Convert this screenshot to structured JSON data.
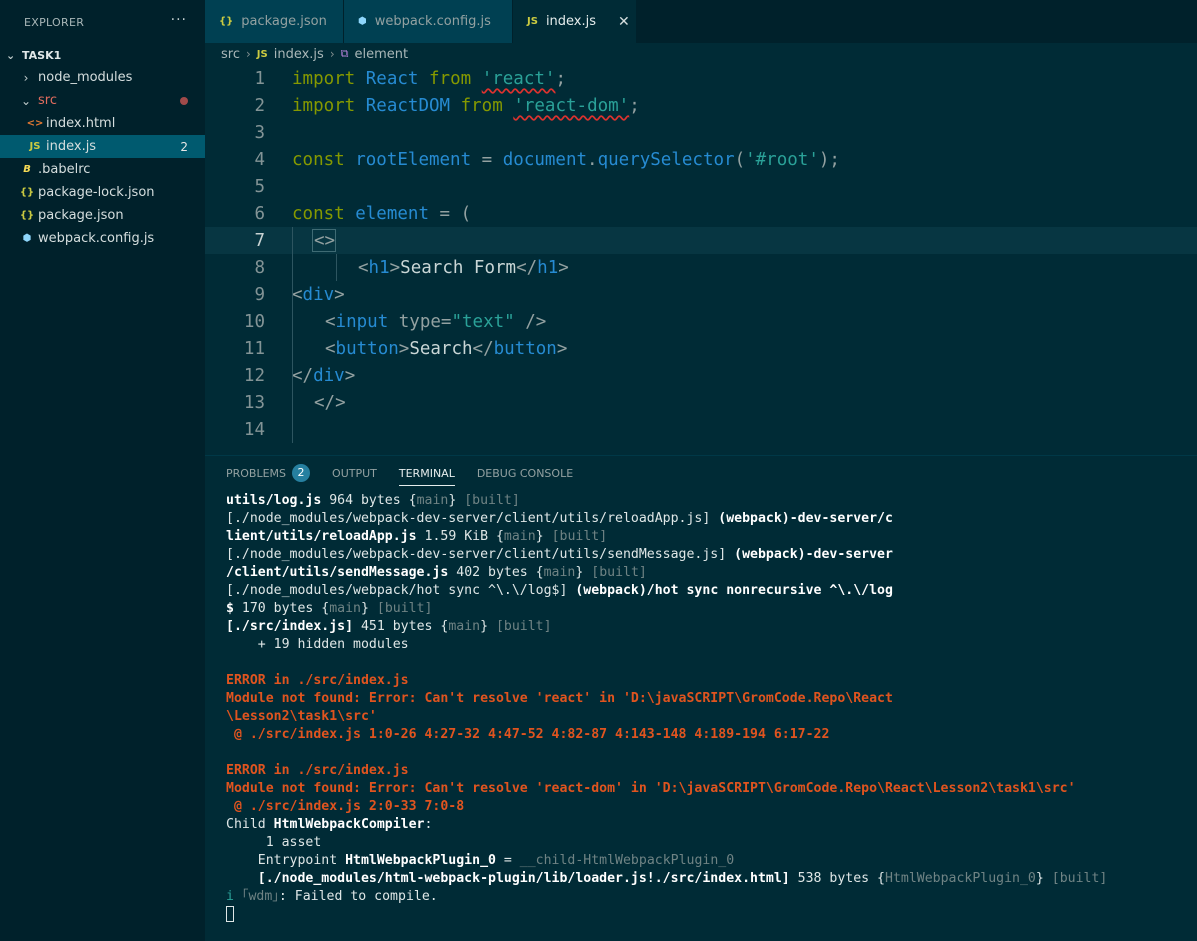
{
  "sidebar": {
    "header": "EXPLORER",
    "more": "···",
    "section": "TASK1",
    "items": [
      {
        "label": "node_modules",
        "icon": "chevron-right-icon",
        "chev": "›"
      },
      {
        "label": "src",
        "icon": "chevron-down-icon",
        "chev": "⌄"
      },
      {
        "label": "index.html",
        "icon_text": "<>"
      },
      {
        "label": "index.js",
        "icon_text": "JS",
        "count": "2"
      },
      {
        "label": ".babelrc",
        "icon_text": "B"
      },
      {
        "label": "package-lock.json",
        "icon_text": "{}"
      },
      {
        "label": "package.json",
        "icon_text": "{}"
      },
      {
        "label": "webpack.config.js",
        "icon_text": "⬢"
      }
    ]
  },
  "tabs": [
    {
      "label": "package.json",
      "icon_text": "{}"
    },
    {
      "label": "webpack.config.js",
      "icon_text": "⬢"
    },
    {
      "label": "index.js",
      "icon_text": "JS",
      "close": "✕"
    }
  ],
  "breadcrumb": {
    "folder": "src",
    "file": "index.js",
    "symbol": "element",
    "file_icon": "JS",
    "symbol_icon": "⧉",
    "sep": "›"
  },
  "editor": {
    "line_numbers": [
      "1",
      "2",
      "3",
      "4",
      "5",
      "6",
      "7",
      "8",
      "9",
      "10",
      "11",
      "12",
      "13",
      "14"
    ],
    "lines": {
      "l1": {
        "kw": "import",
        "id": "React",
        "from": "from",
        "str": "'react'",
        "end": ";"
      },
      "l2": {
        "kw": "import",
        "id": "ReactDOM",
        "from": "from",
        "str": "'react-dom'",
        "end": ";"
      },
      "l4": {
        "kw": "const",
        "id": "rootElement",
        "eq": " = ",
        "obj": "document",
        "dot": ".",
        "fn": "querySelector",
        "open": "(",
        "str": "'#root'",
        "close": ");"
      },
      "l6": {
        "kw": "const",
        "id": "element",
        "rest": " = ("
      },
      "l7": {
        "frag": "<>"
      },
      "l8": {
        "open": "<",
        "tag": "h1",
        "gt": ">",
        "text": "Search Form",
        "close": "</",
        "tag2": "h1",
        "gt2": ">"
      },
      "l9": {
        "open": "<",
        "tag": "div",
        "gt": ">"
      },
      "l10": {
        "open": "<",
        "tag": "input",
        "attr": " type",
        "eq": "=",
        "str": "\"text\"",
        "end": " />"
      },
      "l11": {
        "open": "<",
        "tag": "button",
        "gt": ">",
        "text": "Search",
        "close": "</",
        "tag2": "button",
        "gt2": ">"
      },
      "l12": {
        "open": "</",
        "tag": "div",
        "gt": ">"
      },
      "l13": {
        "frag": "</>"
      }
    }
  },
  "panel": {
    "tabs": [
      {
        "label": "PROBLEMS",
        "badge": "2"
      },
      {
        "label": "OUTPUT"
      },
      {
        "label": "TERMINAL"
      },
      {
        "label": "DEBUG CONSOLE"
      }
    ]
  },
  "terminal": {
    "t1a": "utils/log.js",
    "t1b": " 964 bytes {",
    "t1c": "main",
    "t1d": "} ",
    "t1e": "[built]",
    "t2a": "[./node_modules/webpack-dev-server/client/utils/reloadApp.js] ",
    "t2b": "(webpack)-dev-server/c",
    "t3a": "lient/utils/reloadApp.js",
    "t3b": " 1.59 KiB {",
    "t3c": "main",
    "t3d": "} ",
    "t3e": "[built]",
    "t4a": "[./node_modules/webpack-dev-server/client/utils/sendMessage.js] ",
    "t4b": "(webpack)-dev-server",
    "t5a": "/client/utils/sendMessage.js",
    "t5b": " 402 bytes {",
    "t5c": "main",
    "t5d": "} ",
    "t5e": "[built]",
    "t6a": "[./node_modules/webpack/hot sync ^\\.\\/log$] ",
    "t6b": "(webpack)/hot sync nonrecursive ^\\.\\/log",
    "t7a": "$",
    "t7b": " 170 bytes {",
    "t7c": "main",
    "t7d": "} ",
    "t7e": "[built]",
    "t8a": "[./src/index.js]",
    "t8b": " 451 bytes {",
    "t8c": "main",
    "t8d": "} ",
    "t8e": "[built]",
    "t9": "    + 19 hidden modules",
    "e1": "ERROR in ./src/index.js",
    "e2": "Module not found: Error: Can't resolve 'react' in 'D:\\javaSCRIPT\\GromCode.Repo\\React",
    "e3": "\\Lesson2\\task1\\src'",
    "e4": " @ ./src/index.js 1:0-26 4:27-32 4:47-52 4:82-87 4:143-148 4:189-194 6:17-22",
    "e5": "ERROR in ./src/index.js",
    "e6": "Module not found: Error: Can't resolve 'react-dom' in 'D:\\javaSCRIPT\\GromCode.Repo\\React\\Lesson2\\task1\\src'",
    "e7": " @ ./src/index.js 2:0-33 7:0-8",
    "c1a": "Child ",
    "c1b": "HtmlWebpackCompiler",
    "c1c": ":",
    "c2": "     1 asset",
    "c3a": "    Entrypoint ",
    "c3b": "HtmlWebpackPlugin_0",
    "c3c": " = ",
    "c3d": "__child-HtmlWebpackPlugin_0",
    "c4a": "    [./node_modules/html-webpack-plugin/lib/loader.js!./src/index.html]",
    "c4b": " 538 bytes {",
    "c4c": "HtmlWebpackPlugin_0",
    "c4d": "} ",
    "c4e": "[built]",
    "w1": "i ",
    "w2": "｢wdm｣",
    "w3": ": Failed to compile."
  }
}
